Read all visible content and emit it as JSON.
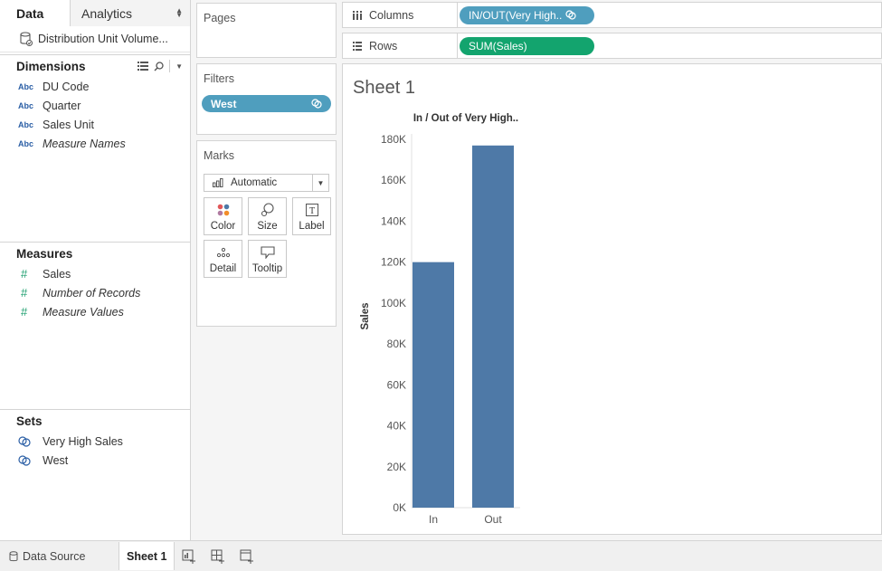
{
  "data_pane": {
    "tab_data": "Data",
    "tab_analytics": "Analytics",
    "datasource_name": "Distribution Unit Volume...",
    "dimensions_title": "Dimensions",
    "dimensions": [
      {
        "type": "Abc",
        "name": "DU Code",
        "italic": false
      },
      {
        "type": "Abc",
        "name": "Quarter",
        "italic": false
      },
      {
        "type": "Abc",
        "name": "Sales Unit",
        "italic": false
      },
      {
        "type": "Abc",
        "name": "Measure Names",
        "italic": true
      }
    ],
    "measures_title": "Measures",
    "measures": [
      {
        "name": "Sales",
        "italic": false
      },
      {
        "name": "Number of Records",
        "italic": true
      },
      {
        "name": "Measure Values",
        "italic": true
      }
    ],
    "sets_title": "Sets",
    "sets": [
      {
        "name": "Very High Sales"
      },
      {
        "name": "West"
      }
    ]
  },
  "pages_card": {
    "title": "Pages"
  },
  "filters_card": {
    "title": "Filters",
    "filter_pill": "West"
  },
  "marks_card": {
    "title": "Marks",
    "mark_type": "Automatic",
    "buttons": [
      "Color",
      "Size",
      "Label",
      "Detail",
      "Tooltip"
    ]
  },
  "shelves": {
    "columns_label": "Columns",
    "columns_pill": "IN/OUT(Very High..",
    "rows_label": "Rows",
    "rows_pill": "SUM(Sales)"
  },
  "view": {
    "sheet_title": "Sheet 1"
  },
  "chart_data": {
    "type": "bar",
    "title": "In / Out of Very High..",
    "categories": [
      "In",
      "Out"
    ],
    "values": [
      120000,
      177000
    ],
    "ylabel": "Sales",
    "xlabel": "",
    "ylim": [
      0,
      180000
    ],
    "yticks": [
      0,
      20000,
      40000,
      60000,
      80000,
      100000,
      120000,
      140000,
      160000,
      180000
    ],
    "ytick_labels": [
      "0K",
      "20K",
      "40K",
      "60K",
      "80K",
      "100K",
      "120K",
      "140K",
      "160K",
      "180K"
    ],
    "bar_color": "#4e79a7",
    "grid": false
  },
  "bottom_bar": {
    "data_source": "Data Source",
    "sheet_tab": "Sheet 1"
  },
  "colors": {
    "filter_pill": "#4f9ebe",
    "measure_pill": "#13a46e",
    "bar": "#4e79a7"
  }
}
